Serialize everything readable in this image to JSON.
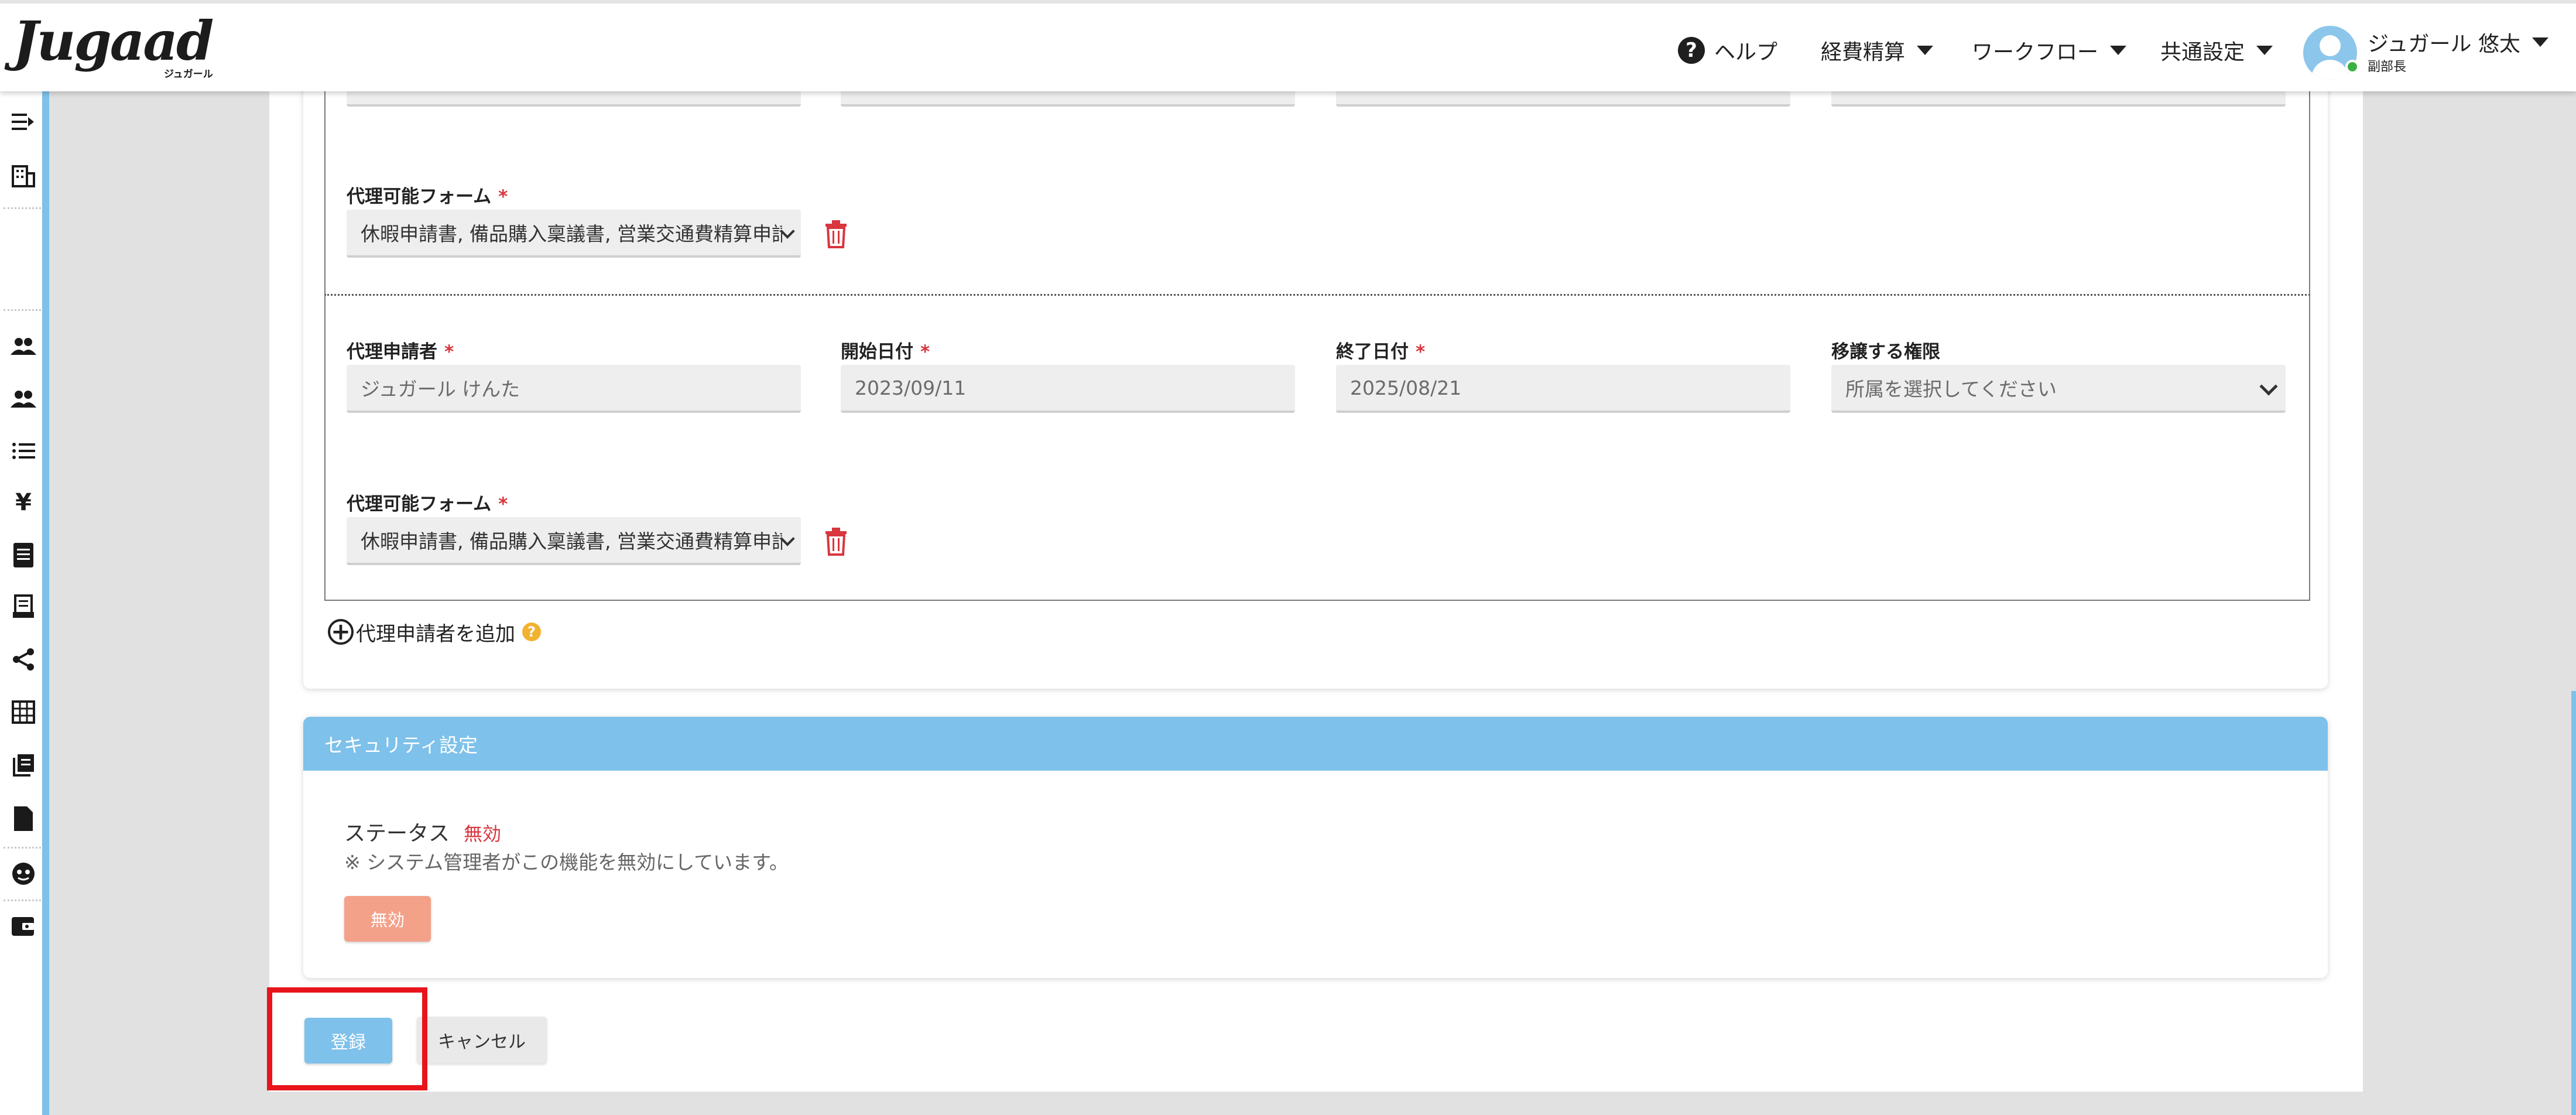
{
  "header": {
    "logo_text": "Jugaad",
    "logo_sub": "ジュガール",
    "help_label": "ヘルプ",
    "nav": [
      "経費精算",
      "ワークフロー",
      "共通設定"
    ],
    "user_name": "ジュガール 悠太",
    "user_role": "副部長"
  },
  "rail_icons": [
    "collapse-icon",
    "building-icon",
    "users-icon",
    "users-alt-icon",
    "list-icon",
    "yen-icon",
    "ledger-icon",
    "receipt-icon",
    "share-icon",
    "table-icon",
    "documents-icon",
    "file-icon",
    "support-icon",
    "wallet-icon"
  ],
  "delegation": {
    "form_label": "代理可能フォーム",
    "form_value": "休暇申請書, 備品購入稟議書, 営業交通費精算申請",
    "applicant_label": "代理申請者",
    "applicant_value": "ジュガール けんた",
    "start_label": "開始日付",
    "start_value": "2023/09/11",
    "end_label": "終了日付",
    "end_value": "2025/08/21",
    "authority_label": "移譲する権限",
    "authority_placeholder": "所属を選択してください",
    "form2_label": "代理可能フォーム",
    "form2_value": "休暇申請書, 備品購入稟議書, 営業交通費精算申請",
    "required_mark": "*",
    "add_label": "代理申請者を追加",
    "help_mark": "?"
  },
  "security": {
    "title": "セキュリティ設定",
    "status_label": "ステータス",
    "status_value": "無効",
    "note": "※ システム管理者がこの機能を無効にしています。",
    "button_label": "無効"
  },
  "actions": {
    "register_label": "登録",
    "cancel_label": "キャンセル"
  },
  "colors": {
    "accent": "#7ec1ea",
    "danger": "#d9363e",
    "disabled_button": "#f4a189",
    "highlight": "#e8141b"
  }
}
